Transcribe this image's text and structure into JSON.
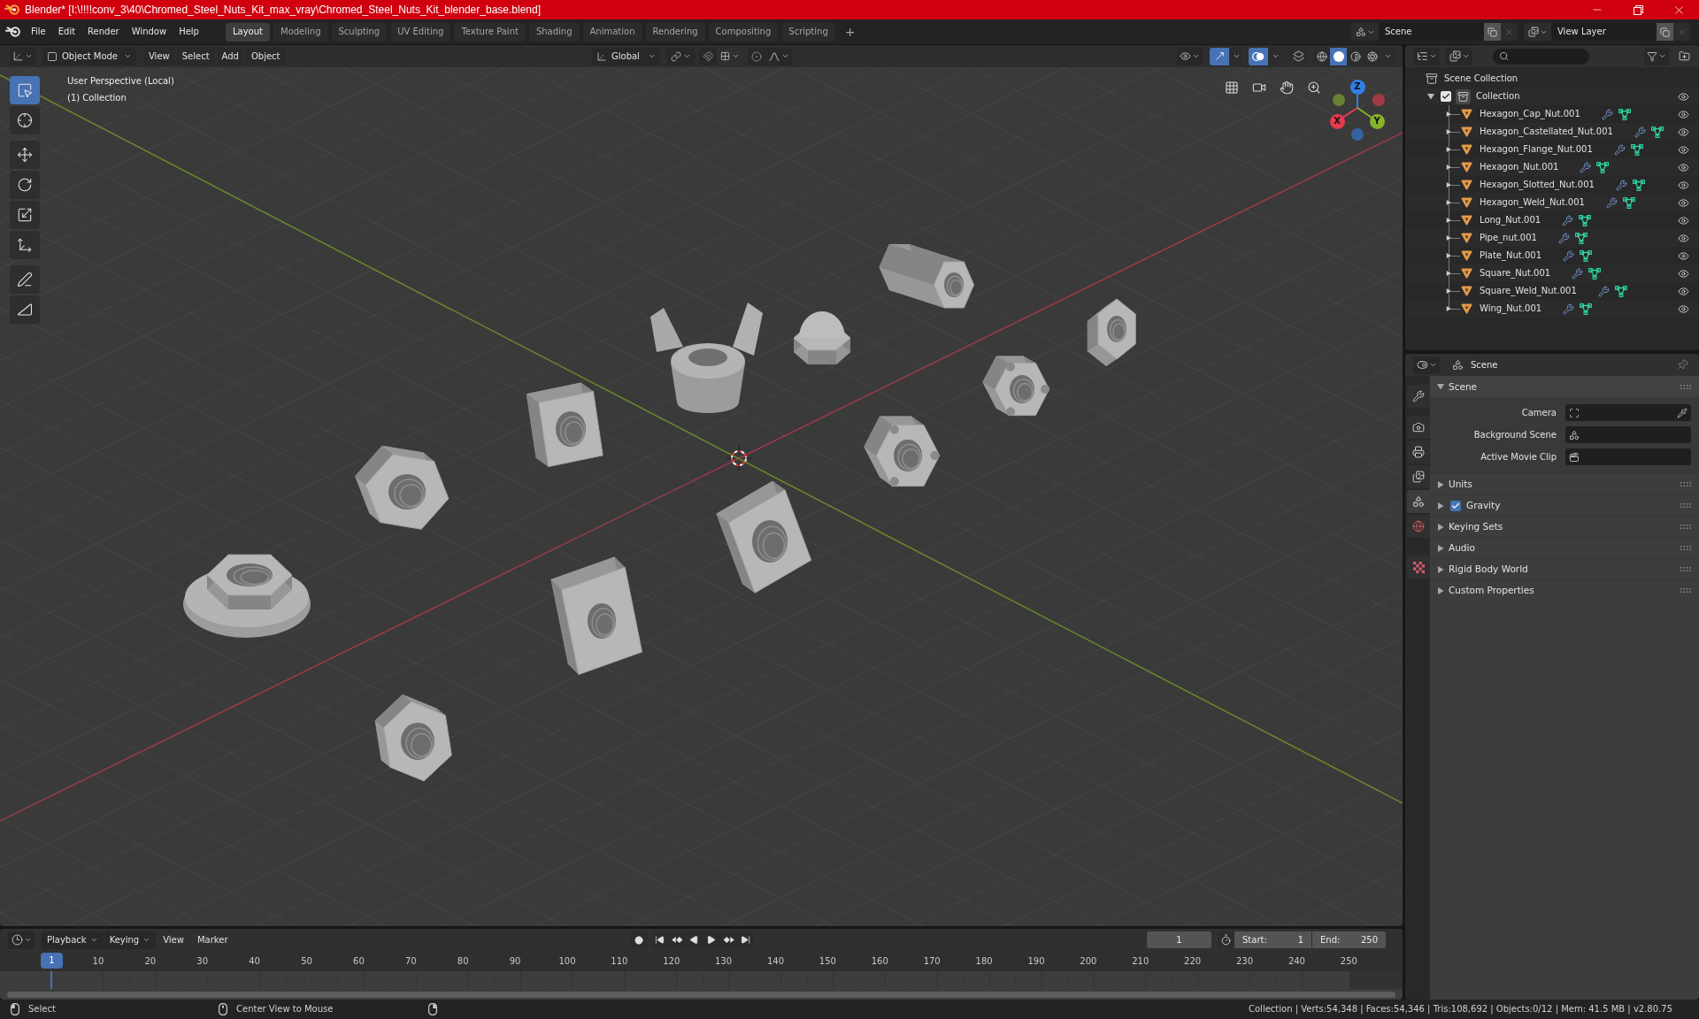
{
  "window": {
    "title": "Blender* [I:\\!!!!conv_3\\40\\Chromed_Steel_Nuts_Kit_max_vray\\Chromed_Steel_Nuts_Kit_blender_base.blend]"
  },
  "menu": [
    "File",
    "Edit",
    "Render",
    "Window",
    "Help"
  ],
  "workspaces": [
    {
      "label": "Layout",
      "selected": true
    },
    {
      "label": "Modeling",
      "selected": false
    },
    {
      "label": "Sculpting",
      "selected": false
    },
    {
      "label": "UV Editing",
      "selected": false
    },
    {
      "label": "Texture Paint",
      "selected": false
    },
    {
      "label": "Shading",
      "selected": false
    },
    {
      "label": "Animation",
      "selected": false
    },
    {
      "label": "Rendering",
      "selected": false
    },
    {
      "label": "Compositing",
      "selected": false
    },
    {
      "label": "Scripting",
      "selected": false
    }
  ],
  "add_workspace": "+",
  "scene": "Scene",
  "view_layer": "View Layer",
  "viewport": {
    "mode": "Object Mode",
    "menus": [
      "View",
      "Select",
      "Add",
      "Object"
    ],
    "orientation": "Global",
    "toggles": [
      {
        "kind": "gizmos",
        "on": true
      },
      {
        "kind": "overlays",
        "on": true
      },
      {
        "kind": "xray",
        "on": false
      }
    ],
    "shading": [
      {
        "kind": "wireframe",
        "selected": false
      },
      {
        "kind": "solid",
        "selected": true
      },
      {
        "kind": "material",
        "selected": false
      },
      {
        "kind": "rendered",
        "selected": false
      }
    ],
    "tools": [
      {
        "kind": "select",
        "selected": true
      },
      {
        "kind": "cursor",
        "selected": false
      },
      {
        "kind": "move",
        "selected": false
      },
      {
        "kind": "rotate",
        "selected": false
      },
      {
        "kind": "scale",
        "selected": false
      },
      {
        "kind": "transform",
        "selected": false
      },
      {
        "kind": "annotate",
        "selected": false
      },
      {
        "kind": "measure",
        "selected": false
      }
    ],
    "info": [
      "User Perspective (Local)",
      "(1) Collection"
    ],
    "axes": [
      {
        "label": "X",
        "color": "#e8394e"
      },
      {
        "label": "Y",
        "color": "#86b32a"
      },
      {
        "label": "Z",
        "color": "#2e80e2"
      }
    ]
  },
  "outliner": {
    "root": "Scene Collection",
    "collection": {
      "name": "Collection",
      "checked": true,
      "expanded": true,
      "visible": true,
      "children": [
        {
          "name": "Hexagon_Cap_Nut.001",
          "expanded": false,
          "visible": true
        },
        {
          "name": "Hexagon_Castellated_Nut.001",
          "expanded": false,
          "visible": true
        },
        {
          "name": "Hexagon_Flange_Nut.001",
          "expanded": false,
          "visible": true
        },
        {
          "name": "Hexagon_Nut.001",
          "expanded": false,
          "visible": true
        },
        {
          "name": "Hexagon_Slotted_Nut.001",
          "expanded": false,
          "visible": true
        },
        {
          "name": "Hexagon_Weld_Nut.001",
          "expanded": false,
          "visible": true
        },
        {
          "name": "Long_Nut.001",
          "expanded": false,
          "visible": true
        },
        {
          "name": "Pipe_nut.001",
          "expanded": false,
          "visible": true
        },
        {
          "name": "Plate_Nut.001",
          "expanded": false,
          "visible": true
        },
        {
          "name": "Square_Nut.001",
          "expanded": false,
          "visible": true
        },
        {
          "name": "Square_Weld_Nut.001",
          "expanded": false,
          "visible": true
        },
        {
          "name": "Wing_Nut.001",
          "expanded": false,
          "visible": true
        }
      ]
    }
  },
  "properties": {
    "context": "Scene",
    "tabs": [
      {
        "kind": "tool",
        "selected": false
      },
      {
        "kind": "render",
        "selected": false
      },
      {
        "kind": "output",
        "selected": false
      },
      {
        "kind": "layers",
        "selected": false
      },
      {
        "kind": "scene",
        "selected": true
      },
      {
        "kind": "world",
        "selected": false
      },
      {
        "kind": "texture",
        "selected": false
      }
    ],
    "panels": [
      {
        "title": "Scene",
        "kind": "plain",
        "expanded": true,
        "fields": [
          {
            "label": "Camera",
            "kind": "camera"
          },
          {
            "label": "Background Scene",
            "kind": "scene"
          },
          {
            "label": "Active Movie Clip",
            "kind": "clip"
          }
        ]
      },
      {
        "title": "Units",
        "kind": "plain",
        "expanded": false
      },
      {
        "title": "Gravity",
        "kind": "toggle",
        "expanded": false,
        "checked": true
      },
      {
        "title": "Keying Sets",
        "kind": "plain",
        "expanded": false
      },
      {
        "title": "Audio",
        "kind": "plain",
        "expanded": false
      },
      {
        "title": "Rigid Body World",
        "kind": "plain",
        "expanded": false
      },
      {
        "title": "Custom Properties",
        "kind": "plain",
        "expanded": false
      }
    ]
  },
  "timeline": {
    "menus": [
      {
        "label": "Playback",
        "kind": "dropdown"
      },
      {
        "label": "Keying",
        "kind": "dropdown"
      },
      {
        "label": "View",
        "kind": "menu"
      },
      {
        "label": "Marker",
        "kind": "menu"
      }
    ],
    "current_frame": "1",
    "start": {
      "label": "Start:",
      "value": "1"
    },
    "end": {
      "label": "End:",
      "value": "250"
    },
    "playhead": "1",
    "ruler": [
      "10",
      "20",
      "30",
      "40",
      "50",
      "60",
      "70",
      "80",
      "90",
      "100",
      "110",
      "120",
      "130",
      "140",
      "150",
      "160",
      "170",
      "180",
      "190",
      "200",
      "210",
      "220",
      "230",
      "240",
      "250"
    ]
  },
  "status_bar": {
    "hints": [
      "Select",
      "Center View to Mouse"
    ],
    "stats": "Collection | Verts:54,348 | Faces:54,346 | Tris:108,692 | Objects:0/12 | Mem: 41.5 MB | v2.80.75"
  }
}
